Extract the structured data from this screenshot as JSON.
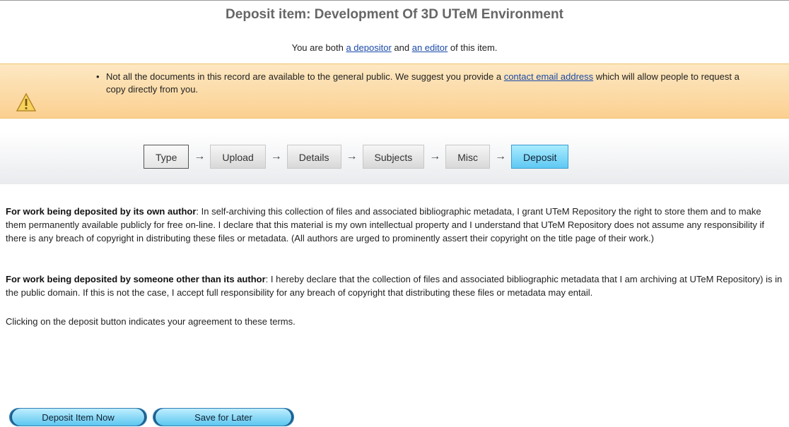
{
  "page": {
    "title": "Deposit item: Development Of 3D UTeM Environment",
    "roles": {
      "prefix": "You are both ",
      "depositor_link": "a depositor",
      "middle": " and ",
      "editor_link": "an editor",
      "suffix": " of this item."
    }
  },
  "warning": {
    "icon": "warning-triangle-icon",
    "text_before": "Not all the documents in this record are available to the general public. We suggest you provide a ",
    "link": "contact email address",
    "text_after": " which will allow people to request a copy directly from you."
  },
  "steps": {
    "items": [
      "Type",
      "Upload",
      "Details",
      "Subjects",
      "Misc",
      "Deposit"
    ],
    "active": "Deposit",
    "arrow": "→"
  },
  "terms": {
    "author_heading": "For work being deposited by its own author",
    "author_text": ": In self-archiving this collection of files and associated bibliographic metadata, I grant UTeM Repository the right to store them and to make them permanently available publicly for free on-line. I declare that this material is my own intellectual property and I understand that UTeM Repository does not assume any responsibility if there is any breach of copyright in distributing these files or metadata. (All authors are urged to prominently assert their copyright on the title page of their work.)",
    "other_heading": "For work being deposited by someone other than its author",
    "other_text": ": I hereby declare that the collection of files and associated bibliographic metadata that I am archiving at UTeM Repository) is in the public domain. If this is not the case, I accept full responsibility for any breach of copyright that distributing these files or metadata may entail.",
    "agreement": "Clicking on the deposit button indicates your agreement to these terms."
  },
  "buttons": {
    "deposit": "Deposit Item Now",
    "save": "Save for Later"
  }
}
